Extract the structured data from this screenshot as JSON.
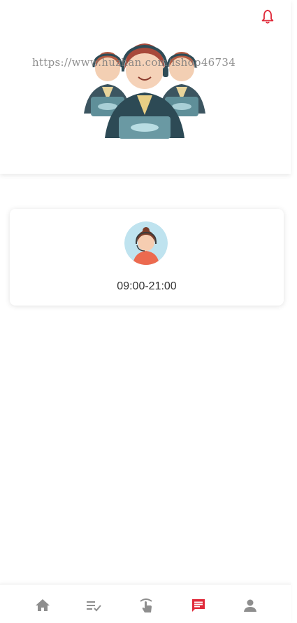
{
  "header": {
    "watermark_text": "https://www.huzhan.com/ishop46734",
    "bell_icon": "bell-icon"
  },
  "service_card": {
    "hours": "09:00-21:00",
    "avatar_icon": "customer-service-avatar-icon"
  },
  "tabbar": {
    "items": [
      {
        "icon": "home-icon",
        "active": false
      },
      {
        "icon": "list-check-icon",
        "active": false
      },
      {
        "icon": "tap-hand-icon",
        "active": false
      },
      {
        "icon": "message-icon",
        "active": true
      },
      {
        "icon": "user-icon",
        "active": false
      }
    ]
  },
  "colors": {
    "accent": "#e02a3a",
    "inactive": "#8e8e8e"
  }
}
